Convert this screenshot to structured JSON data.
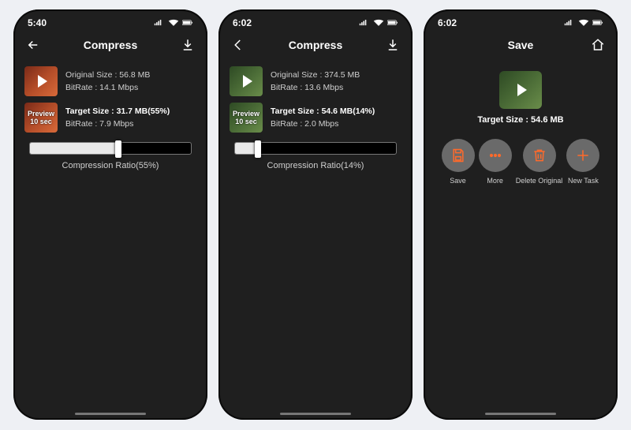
{
  "screens": {
    "s1": {
      "time": "5:40",
      "title": "Compress",
      "orig_thumb_variant": "red",
      "orig_size_line": "Original Size : 56.8 MB",
      "orig_bitrate_line": "BitRate : 14.1 Mbps",
      "preview_top": "Preview",
      "preview_bot": "10 sec",
      "target_line": "Target Size : 31.7 MB(55%)",
      "target_bitrate_line": "BitRate : 7.9 Mbps",
      "slider_pct": 55,
      "ratio_label": "Compression Ratio(55%)"
    },
    "s2": {
      "time": "6:02",
      "title": "Compress",
      "orig_thumb_variant": "green",
      "orig_size_line": "Original Size : 374.5 MB",
      "orig_bitrate_line": "BitRate : 13.6 Mbps",
      "preview_top": "Preview",
      "preview_bot": "10 sec",
      "target_line": "Target Size : 54.6 MB(14%)",
      "target_bitrate_line": "BitRate : 2.0 Mbps",
      "slider_pct": 14,
      "ratio_label": "Compression Ratio(14%)"
    },
    "s3": {
      "time": "6:02",
      "title": "Save",
      "target_size": "Target Size : 54.6 MB",
      "actions": {
        "save": "Save",
        "more": "More",
        "delete": "Delete Original",
        "newtask": "New Task"
      }
    }
  }
}
